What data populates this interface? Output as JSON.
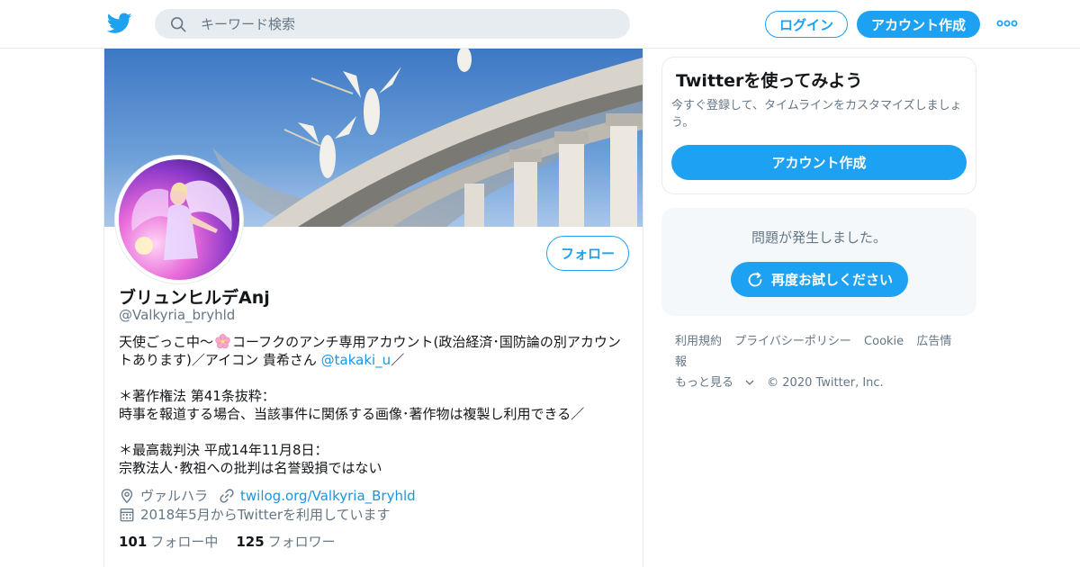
{
  "header": {
    "search_placeholder": "キーワード検索",
    "login_label": "ログイン",
    "signup_label": "アカウント作成"
  },
  "profile": {
    "name": "ブリュンヒルデAnj",
    "handle": "@Valkyria_bryhld",
    "follow_label": "フォロー",
    "bio": {
      "line1_a": "天使ごっこ中～",
      "line1_b": "コーフクのアンチ専用アカウント(政治経済･国防論の別アカウントあります)／アイコン 貴希さん ",
      "line1_link": "@takaki_u",
      "line1_end": "／",
      "line3": "＊著作権法 第41条抜粋：",
      "line4": "時事を報道する場合、当該事件に関係する画像･著作物は複製し利用できる／",
      "line6": "＊最高裁判決 平成14年11月8日：",
      "line7": "宗教法人･教祖への批判は名誉毀損ではない"
    },
    "location": "ヴァルハラ",
    "website": "twilog.org/Valkyria_Bryhld",
    "joined": "2018年5月からTwitterを利用しています",
    "following_count": "101",
    "following_label": "フォロー中",
    "followers_count": "125",
    "followers_label": "フォロワー"
  },
  "signup_card": {
    "title": "Twitterを使ってみよう",
    "description": "今すぐ登録して、タイムラインをカスタマイズしましょう。",
    "button_label": "アカウント作成"
  },
  "error_card": {
    "message": "問題が発生しました。",
    "retry_label": "再度お試しください"
  },
  "footer": {
    "terms": "利用規約",
    "privacy": "プライバシーポリシー",
    "cookie": "Cookie",
    "ads": "広告情報",
    "more": "もっと見る",
    "copyright": "© 2020 Twitter, Inc."
  },
  "colors": {
    "accent": "#1da1f2",
    "link": "#1b95e0",
    "secondary_text": "#657786"
  }
}
